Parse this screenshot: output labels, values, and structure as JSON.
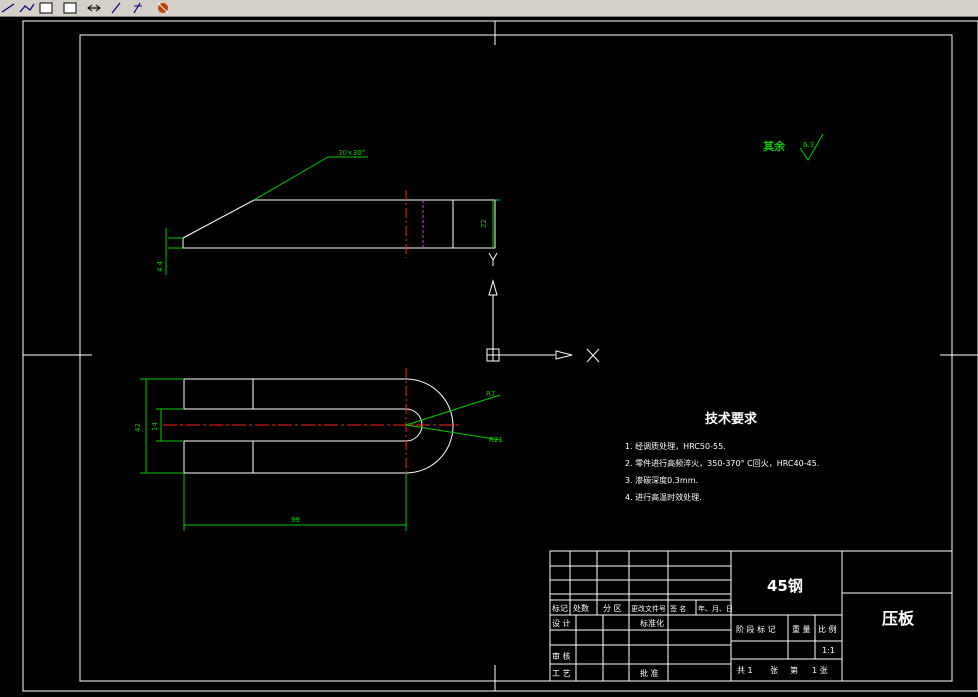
{
  "toolbar": {
    "buttons": [
      "line-tool",
      "polyline-tool",
      "rectangle-tool",
      "copy-tool",
      "move-tool",
      "extend-tool",
      "trim-tool",
      "explode-tool"
    ]
  },
  "drawing": {
    "chamfer_note": "30×30°",
    "dim_height_side": "22",
    "dim_small_side": "4.4",
    "dim_width_plan": "42",
    "dim_slot": "14",
    "dim_length": "99",
    "dim_r1": "R7",
    "dim_r2": "R21",
    "roughness_prefix": "其余",
    "roughness_value": "6.3",
    "ucs_x": "X",
    "ucs_y": "Y"
  },
  "tech": {
    "title": "技术要求",
    "items": [
      "1. 经调质处理，HRC50-55.",
      "2. 零件进行高频淬火，350-370° C回火，HRC40-45.",
      "3. 渗碳深度0.3mm.",
      "4. 进行高温时效处理."
    ]
  },
  "titleblock": {
    "material": "45钢",
    "part_name": "压板",
    "h_mark": "标记",
    "h_count": "处数",
    "h_zone": "分 区",
    "h_doc": "更改文件号",
    "h_sign": "签 名",
    "h_date": "年、月、日",
    "r_design": "设 计",
    "r_standard": "标准化",
    "r_review": "审 核",
    "r_process": "工 艺",
    "r_approve": "批 准",
    "stage_label": "阶 段 标 记",
    "weight_label": "重 量",
    "scale_label": "比 例",
    "scale_value": "1:1",
    "sheet_total": "共 1",
    "sheet_word": "张",
    "sheet_no": "第",
    "sheet_count": "1 张"
  }
}
